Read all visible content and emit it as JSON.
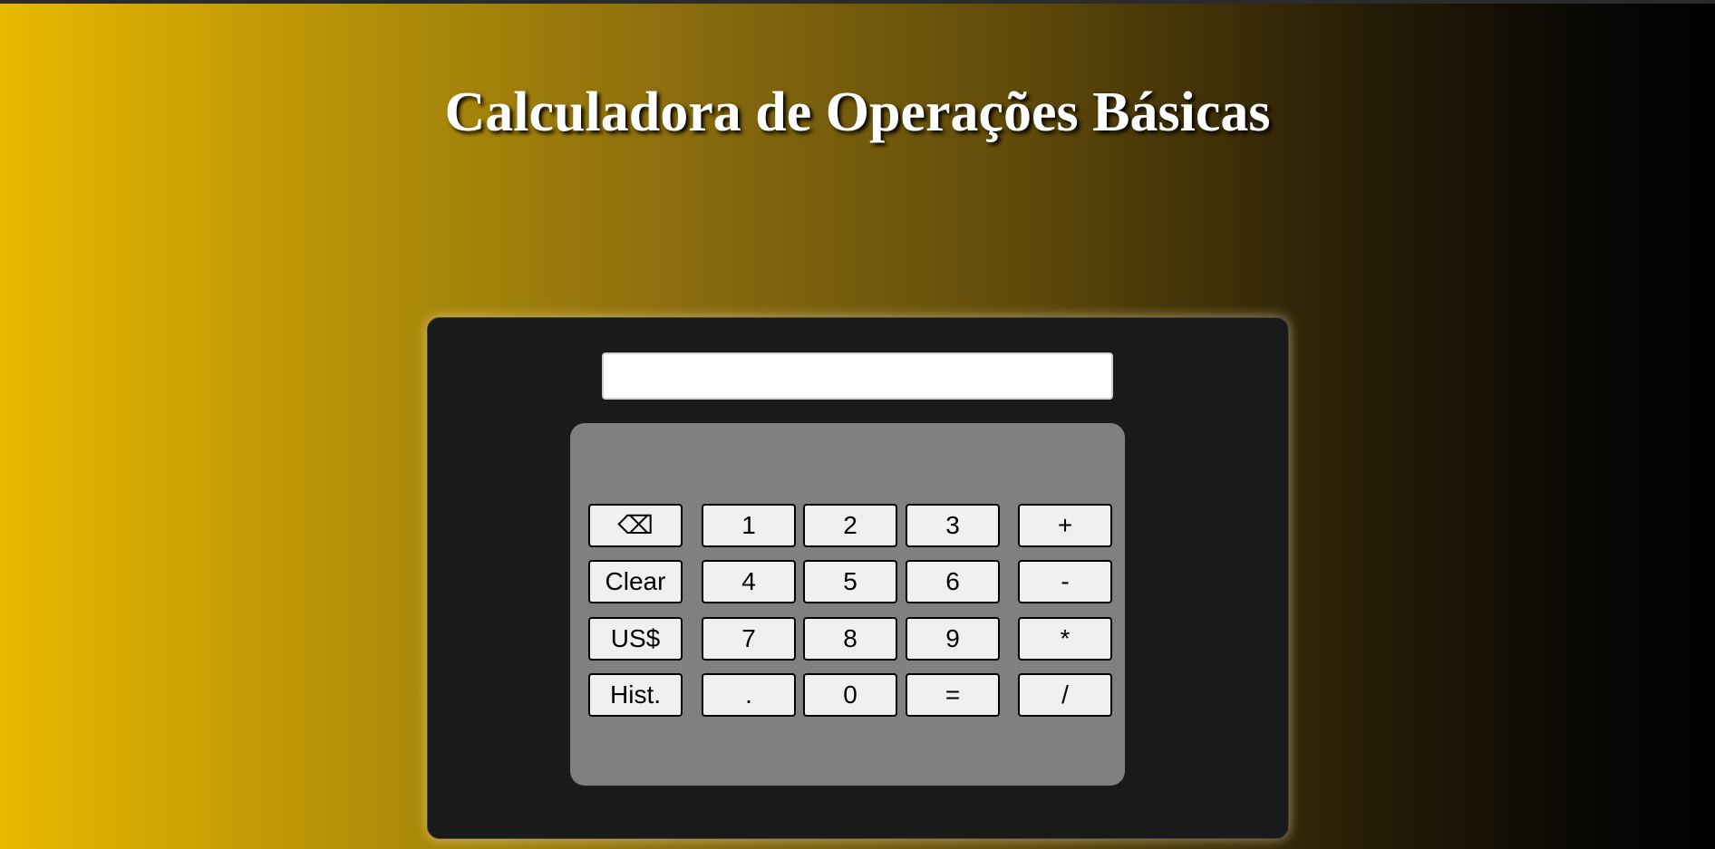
{
  "page": {
    "title": "Calculadora de Operações Básicas",
    "gradient_colors": [
      "#e8b800",
      "#8a6c0e",
      "#000000"
    ]
  },
  "display": {
    "value": ""
  },
  "keys": {
    "backspace": "⌫",
    "clear": "Clear",
    "usd": "US$",
    "history": "Hist.",
    "one": "1",
    "two": "2",
    "three": "3",
    "four": "4",
    "five": "5",
    "six": "6",
    "seven": "7",
    "eight": "8",
    "nine": "9",
    "dot": ".",
    "zero": "0",
    "equals": "=",
    "plus": "+",
    "minus": "-",
    "multiply": "*",
    "divide": "/"
  }
}
